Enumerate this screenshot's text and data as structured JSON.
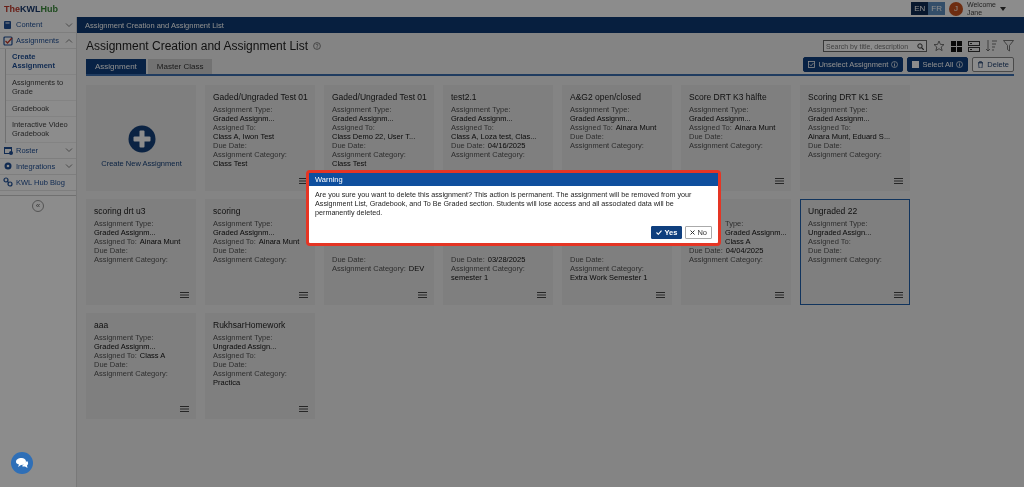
{
  "logo": [
    "The",
    "KWL",
    "Hub"
  ],
  "languages": [
    {
      "label": "EN",
      "selected": true
    },
    {
      "label": "FR",
      "selected": false
    }
  ],
  "user": {
    "initial": "J",
    "greeting": "Welcome",
    "name": "Jane"
  },
  "sidebar": {
    "items": [
      {
        "label": "Content",
        "expanded": false
      },
      {
        "label": "Assignments",
        "expanded": true,
        "children": [
          {
            "label": "Create Assignment",
            "selected": true
          },
          {
            "label": "Assignments to Grade",
            "selected": false
          },
          {
            "label": "Gradebook",
            "selected": false
          },
          {
            "label": "Interactive Video Gradebook",
            "selected": false
          }
        ]
      },
      {
        "label": "Roster",
        "expanded": false
      },
      {
        "label": "Integrations",
        "expanded": false
      },
      {
        "label": "KWL Hub Blog"
      }
    ],
    "collapse_label": "«"
  },
  "breadcrumb": "Assignment Creation and Assignment List",
  "page_title": "Assignment Creation and Assignment List",
  "search": {
    "placeholder": "Search by title, description"
  },
  "tabs": [
    {
      "label": "Assignment",
      "selected": true
    },
    {
      "label": "Master Class",
      "selected": false
    }
  ],
  "actions": [
    {
      "label": "Unselect Assignment",
      "kind": "primary",
      "info": true
    },
    {
      "label": "Select All",
      "kind": "primary",
      "info": true
    },
    {
      "label": "Delete",
      "kind": "outline",
      "info": false
    }
  ],
  "create_card": {
    "label": "Create New Assignment"
  },
  "cards": [
    {
      "title": "Gaded/Ungraded Test 01",
      "selected": false,
      "menu_icon": true,
      "assignment_type": {
        "label": "Assignment Type:",
        "value": "Graded Assignm..."
      },
      "assigned_to": {
        "label": "Assigned To:",
        "value": "Class A, Iwon Test"
      },
      "due_date": {
        "label": "Due Date:"
      },
      "assignment_category": {
        "label": "Assignment Category:",
        "value": "Class Test"
      }
    },
    {
      "title": "Gaded/Ungraded Test 01",
      "selected": false,
      "menu_icon": false,
      "assignment_type": {
        "label": "Assignment Type:",
        "value": "Graded Assignm..."
      },
      "assigned_to": {
        "label": "Assigned To:",
        "value": "Class Demo 22, User T..."
      },
      "due_date": {
        "label": "Due Date:"
      },
      "assignment_category": {
        "label": "Assignment Category:",
        "value": "Class Test"
      }
    },
    {
      "title": "test2.1",
      "selected": false,
      "menu_icon": false,
      "assignment_type": {
        "label": "Assignment Type:",
        "value": "Graded Assignm..."
      },
      "assigned_to": {
        "label": "Assigned To:",
        "value": "Class A, Loza test, Clas..."
      },
      "due_date": {
        "label": "Due Date:",
        "value": "04/16/2025"
      },
      "assignment_category": {
        "label": "Assignment Category:"
      }
    },
    {
      "title": "A&G2 open/closed",
      "selected": false,
      "menu_icon": false,
      "assignment_type": {
        "label": "Assignment Type:",
        "value": "Graded Assignm..."
      },
      "assigned_to": {
        "label": "Assigned To:",
        "value": "Ainara Munt"
      },
      "due_date": {
        "label": "Due Date:"
      },
      "assignment_category": {
        "label": "Assignment Category:"
      }
    },
    {
      "title": "Score DRT K3 hälfte",
      "selected": false,
      "menu_icon": true,
      "assignment_type": {
        "label": "Assignment Type:",
        "value": "Graded Assignm..."
      },
      "assigned_to": {
        "label": "Assigned To:",
        "value": "Ainara Munt"
      },
      "due_date": {
        "label": "Due Date:"
      },
      "assignment_category": {
        "label": "Assignment Category:"
      }
    },
    {
      "title": "Scoring DRT K1 SE",
      "selected": false,
      "menu_icon": true,
      "assignment_type": {
        "label": "Assignment Type:",
        "value": "Graded Assignm..."
      },
      "assigned_to": {
        "label": "Assigned To:",
        "value": "Ainara Munt, Eduard S..."
      },
      "due_date": {
        "label": "Due Date:"
      },
      "assignment_category": {
        "label": "Assignment Category:"
      }
    },
    {
      "title": "scoring drt u3",
      "selected": false,
      "menu_icon": true,
      "assignment_type": {
        "label": "Assignment Type:",
        "value": "Graded Assignm..."
      },
      "assigned_to": {
        "label": "Assigned To:",
        "value": "Ainara Munt"
      },
      "due_date": {
        "label": "Due Date:"
      },
      "assignment_category": {
        "label": "Assignment Category:"
      }
    },
    {
      "title": "scoring",
      "selected": false,
      "menu_icon": true,
      "assignment_type": {
        "label": "Assignment Type:",
        "value": "Graded Assignm..."
      },
      "assigned_to": {
        "label": "Assigned To:",
        "value": "Ainara Munt"
      },
      "due_date": {
        "label": "Due Date:"
      },
      "assignment_category": {
        "label": "Assignment Category:"
      }
    },
    {
      "selected": false,
      "menu_icon": true,
      "due_date": {
        "label": "Due Date:"
      },
      "assignment_category": {
        "label": "Assignment Category:",
        "value": "DEV"
      }
    },
    {
      "selected": false,
      "menu_icon": true,
      "due_date": {
        "label": "Due Date:",
        "value": "03/28/2025"
      },
      "assignment_category": {
        "label": "Assignment Category:",
        "value": "semester 1"
      }
    },
    {
      "selected": false,
      "menu_icon": true,
      "due_date": {
        "label": "Due Date:"
      },
      "assignment_category": {
        "label": "Assignment Category:",
        "value": "Extra Work Semester 1"
      }
    },
    {
      "selected": false,
      "menu_icon": true,
      "assignment_type": {
        "label": "Type:",
        "value": "Graded Assignm..."
      },
      "assigned_to": {
        "value": "Class A"
      },
      "due_date": {
        "label": "Due Date:",
        "value": "04/04/2025"
      },
      "assignment_category": {
        "label": "Assignment Category:"
      }
    },
    {
      "title": "Ungraded 22",
      "selected": true,
      "menu_icon": true,
      "assignment_type": {
        "label": "Assignment Type:",
        "value": "Ungraded Assign..."
      },
      "assigned_to": {
        "label": "Assigned To:"
      },
      "due_date": {
        "label": "Due Date:"
      },
      "assignment_category": {
        "label": "Assignment Category:"
      }
    },
    {
      "title": "aaa",
      "selected": false,
      "menu_icon": true,
      "assignment_type": {
        "label": "Assignment Type:",
        "value": "Graded Assignm..."
      },
      "assigned_to": {
        "label": "Assigned To:",
        "value": "Class A"
      },
      "due_date": {
        "label": "Due Date:"
      },
      "assignment_category": {
        "label": "Assignment Category:"
      }
    },
    {
      "title": "RukhsarHomework",
      "selected": false,
      "menu_icon": true,
      "assignment_type": {
        "label": "Assignment Type:",
        "value": "Ungraded Assign..."
      },
      "assigned_to": {
        "label": "Assigned To:"
      },
      "due_date": {
        "label": "Due Date:"
      },
      "assignment_category": {
        "label": "Assignment Category:",
        "value": "Practica"
      }
    }
  ],
  "dialog": {
    "title": "Warning",
    "message": "Are you sure you want to delete this assignment? This action is permanent. The assignment will be removed from your Assignment List, Gradebook, and To Be Graded section. Students will lose access and all associated data will be permanently deleted.",
    "buttons": [
      {
        "label": "Yes",
        "kind": "confirm"
      },
      {
        "label": "No",
        "kind": "cancel"
      }
    ]
  }
}
